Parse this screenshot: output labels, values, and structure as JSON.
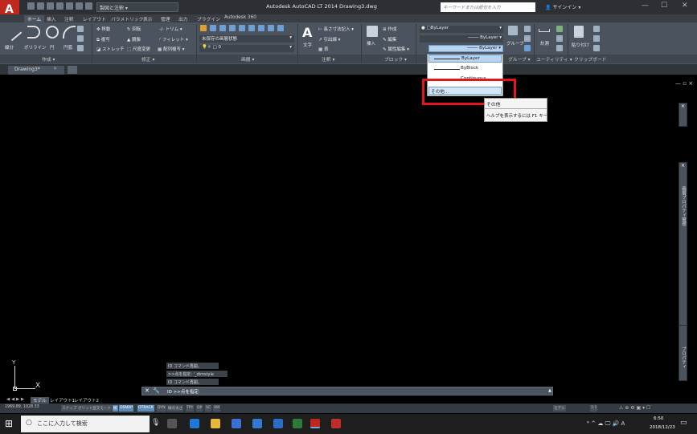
{
  "titlebar": {
    "workspace": "製図と注釈",
    "title": "Autodesk AutoCAD LT 2014    Drawing3.dwg",
    "search_placeholder": "キーワードまたは語句を入力",
    "signin": "サインイン"
  },
  "ribbon_tabs": [
    "ホーム",
    "挿入",
    "注釈",
    "レイアウト",
    "パラメトリック",
    "表示",
    "管理",
    "出力",
    "プラグイン",
    "Autodesk 360"
  ],
  "ribbon": {
    "draw": {
      "line": "線分",
      "polyline": "ポリライン",
      "circle": "円",
      "arc": "円弧",
      "label": "作成"
    },
    "modify": {
      "move": "移動",
      "rotate": "回転",
      "trim": "トリム",
      "copy": "複写",
      "mirror": "鏡像",
      "fillet": "フィレット",
      "stretch": "ストレッチ",
      "scale": "尺度変更",
      "array": "配列複写",
      "label": "修正"
    },
    "layers": {
      "state": "未保存の画層状態",
      "current": "0",
      "label": "画層"
    },
    "annotation": {
      "text": "文字",
      "dim": "長さ寸法記入",
      "leader": "引出線",
      "table": "表",
      "label": "注釈"
    },
    "block": {
      "insert": "挿入",
      "create": "作成",
      "edit": "編集",
      "attr": "属性編集",
      "label": "ブロック"
    },
    "properties": {
      "color": "ByLayer",
      "lineweight": "ByLayer",
      "linetype": "ByLayer"
    },
    "groups": {
      "group": "グループ",
      "label": "グループ"
    },
    "utilities": {
      "measure": "計測",
      "label": "ユーティリティ"
    },
    "clipboard": {
      "paste": "貼り付け",
      "label": "クリップボード"
    }
  },
  "doc_tab": "Drawing3*",
  "dropdown": {
    "items": [
      "ByLayer",
      "ByBlock",
      "Continuous"
    ],
    "other": "その他..."
  },
  "tooltip": {
    "title": "その他",
    "help": "ヘルプを表示するには F1 キー"
  },
  "palettes": {
    "layer_props": "画層プロパティ管理",
    "properties": "プロパティ"
  },
  "command": {
    "history": [
      "ID コマンド再開。",
      ">>点を指定: '_dimstyle",
      "ID コマンド再開。"
    ],
    "prompt": "ID >>点を指定:"
  },
  "layout_tabs": [
    "モデル",
    "レイアウト1",
    "レイアウト2"
  ],
  "status": {
    "coords": "1969.89, 1028.33",
    "buttons": [
      "スナップ",
      "グリッド",
      "直交モード",
      "極",
      "OSNAP",
      "OTRACK",
      "DYN",
      "線の太さ",
      "TPY",
      "QP",
      "SC",
      "AM"
    ],
    "model": "モデル",
    "scale": "1:1"
  },
  "taskbar": {
    "search": "ここに入力して検索",
    "time": "6:50",
    "date": "2018/12/23"
  }
}
